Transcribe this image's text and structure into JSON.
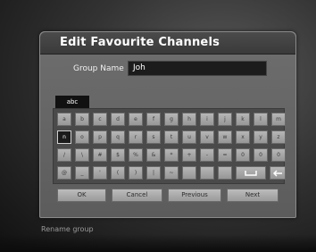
{
  "dialog": {
    "title": "Edit Favourite Channels",
    "group_name_label": "Group Name",
    "group_name_value": "Joh",
    "mode_label": "abc"
  },
  "keyboard": {
    "rows": [
      [
        "a",
        "b",
        "c",
        "d",
        "e",
        "f",
        "g",
        "h",
        "i",
        "j",
        "k",
        "l",
        "m"
      ],
      [
        "n",
        "o",
        "p",
        "q",
        "r",
        "s",
        "t",
        "u",
        "v",
        "w",
        "x",
        "y",
        "z"
      ],
      [
        "/",
        "\\",
        "#",
        "$",
        "%",
        "&",
        "*",
        "+",
        "-",
        "=",
        "0",
        "0",
        "0"
      ],
      [
        "@",
        "_",
        "'",
        "(",
        ")",
        "|",
        "~",
        "space",
        "backspace"
      ]
    ],
    "selected_key": "n"
  },
  "buttons": {
    "ok": "OK",
    "cancel": "Cancel",
    "previous": "Previous",
    "next": "Next"
  },
  "status": {
    "text": "Rename group"
  },
  "colors": {
    "dialog_bg": "#6e6e6e",
    "title_bar": "#3a3a3a",
    "key_bg": "#b0b0b0",
    "selected_key_bg": "#1b1b1b"
  }
}
